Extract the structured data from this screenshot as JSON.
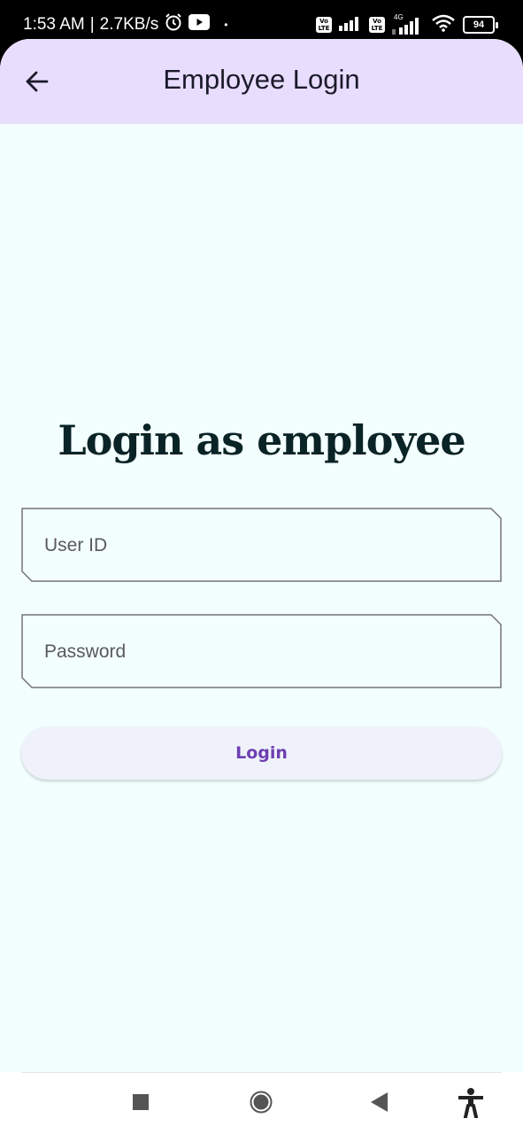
{
  "status_bar": {
    "time": "1:53 AM",
    "separator": "|",
    "net_speed": "2.7KB/s",
    "dot": "•",
    "volte1": "Vo LTE",
    "volte2": "Vo LTE",
    "network_type": "4G",
    "battery": "94"
  },
  "app_bar": {
    "title": "Employee Login",
    "background": "#e8ddfd"
  },
  "main": {
    "heading": "Login as employee",
    "user_id_placeholder": "User ID",
    "password_placeholder": "Password",
    "login_label": "Login",
    "background": "#f3fefe",
    "accent": "#6c3fb0"
  },
  "nav": {
    "icons": [
      "recents-square-icon",
      "home-circle-icon",
      "back-triangle-icon",
      "accessibility-icon"
    ]
  }
}
